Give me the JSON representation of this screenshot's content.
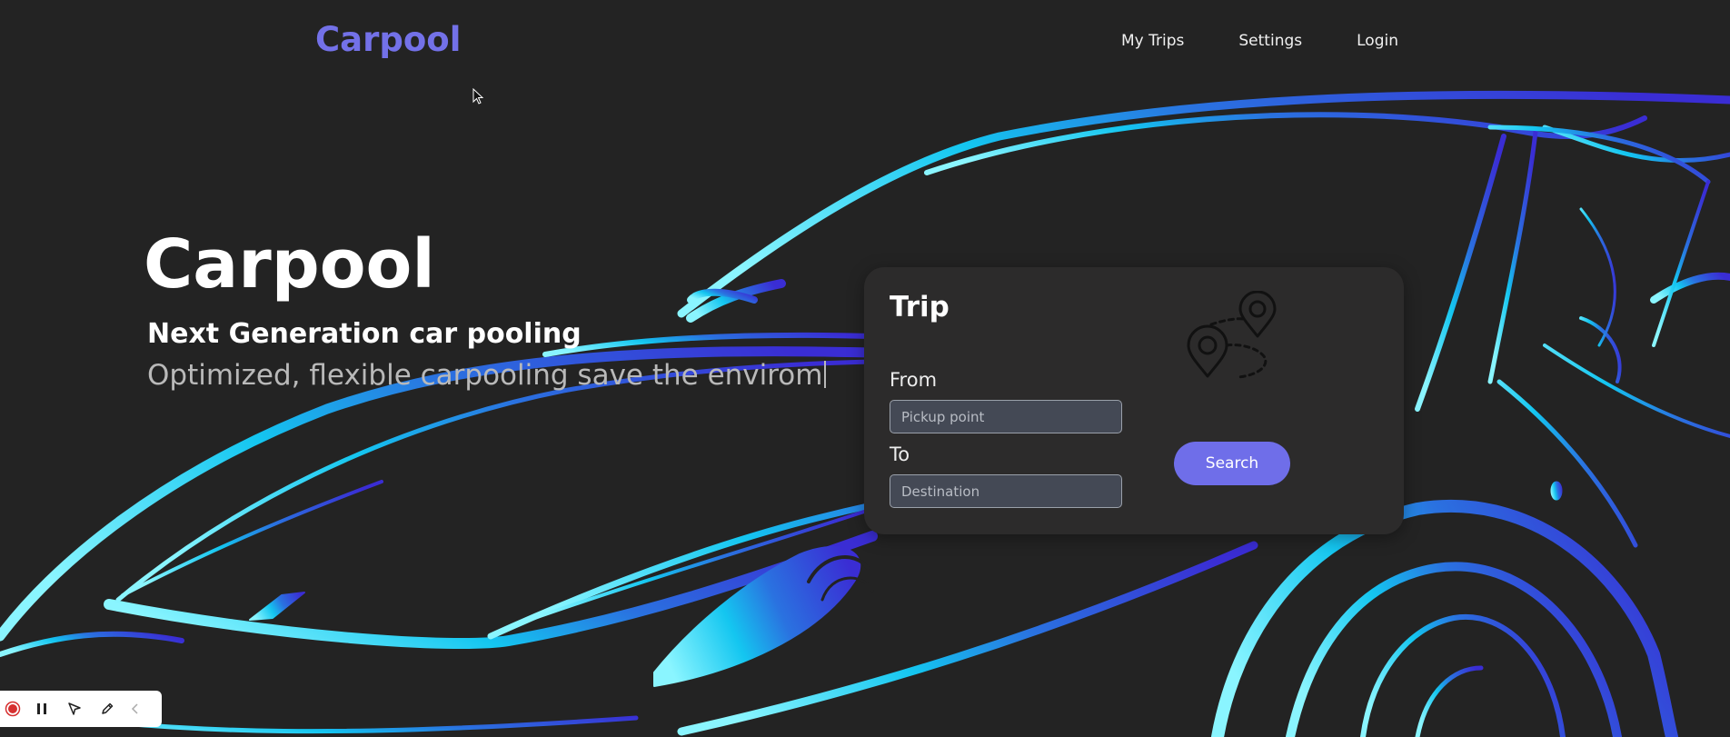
{
  "header": {
    "brand": "Carpool",
    "nav": [
      {
        "label": "My Trips"
      },
      {
        "label": "Settings"
      },
      {
        "label": "Login"
      }
    ]
  },
  "hero": {
    "title": "Carpool",
    "subtitle": "Next Generation car pooling",
    "tagline": "Optimized, flexible carpooling save the envirom"
  },
  "trip_form": {
    "title": "Trip",
    "from_label": "From",
    "from_placeholder": "Pickup point",
    "from_value": "",
    "to_label": "To",
    "to_placeholder": "Destination",
    "to_value": "",
    "search_label": "Search"
  },
  "colors": {
    "background": "#232323",
    "brand": "#7371e8",
    "accent": "#6f6ee9",
    "card": "#2c2b2b",
    "car_gradient_start": "#7ff0ff",
    "car_gradient_end": "#3a2fd6"
  },
  "recorder_toolbar": {
    "icons": [
      "record-icon",
      "pause-icon",
      "pointer-icon",
      "pen-icon",
      "chevron-left-icon"
    ]
  }
}
